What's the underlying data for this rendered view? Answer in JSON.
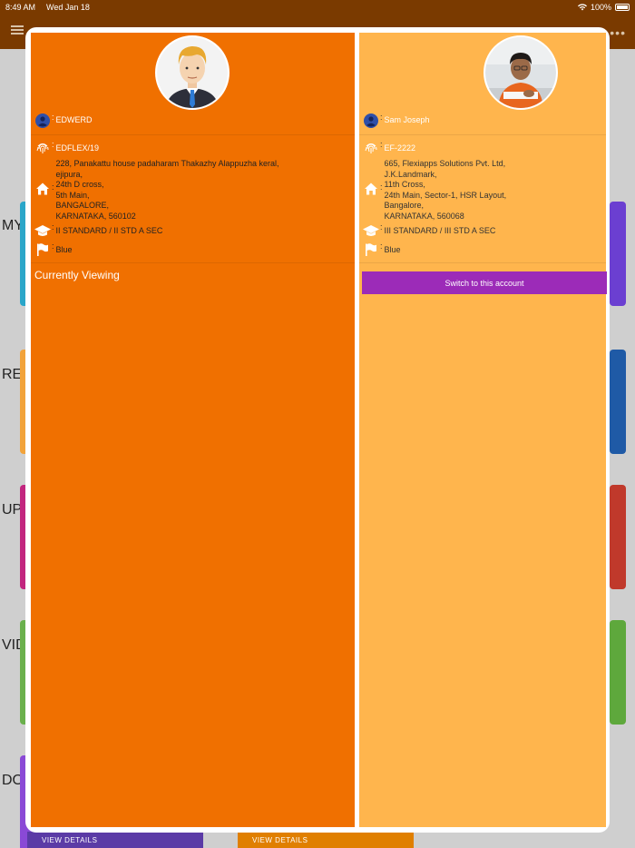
{
  "status_bar": {
    "time": "8:49 AM",
    "date": "Wed Jan 18",
    "battery": "100%"
  },
  "background": {
    "labels": [
      "MY",
      "RES",
      "UP",
      "VID",
      "DO"
    ],
    "bottom_buttons": [
      "VIEW DETAILS",
      "VIEW DETAILS"
    ],
    "tile_colors_left": [
      "#2aa6c9",
      "#f2a33a",
      "#c2267f",
      "#6ab04c",
      "#8a49d6"
    ],
    "tile_colors_right": [
      "#6b3fd1",
      "#1f5aa6",
      "#c0392b",
      "#5ea83c"
    ]
  },
  "accounts": {
    "current": {
      "name": "EDWERD",
      "id": "EDFLEX/19",
      "address_lines": [
        "228, Panakattu house padaharam Thakazhy Alappuzha keral,",
        "ejipura,",
        "24th D cross,",
        "5th Main,",
        "BANGALORE,",
        "KARNATAKA, 560102"
      ],
      "class": "II STANDARD / II STD A SEC",
      "house": "Blue",
      "status_label": "Currently Viewing",
      "card_color": "#f07000"
    },
    "other": {
      "name": "Sam Joseph",
      "id": "EF-2222",
      "address_lines": [
        "665, Flexiapps Solutions Pvt. Ltd,",
        "J.K.Landmark,",
        "11th Cross,",
        "24th Main, Sector-1, HSR Layout,",
        "Bangalore,",
        "KARNATAKA, 560068"
      ],
      "class": "III STANDARD / III STD A SEC",
      "house": "Blue",
      "switch_label": "Switch to this account",
      "card_color": "#ffb54d",
      "button_color": "#9c2bb8"
    }
  },
  "icons": {
    "user": "user-circle-icon",
    "id": "fingerprint-icon",
    "address": "home-icon",
    "class": "graduation-cap-icon",
    "house": "flag-icon"
  }
}
